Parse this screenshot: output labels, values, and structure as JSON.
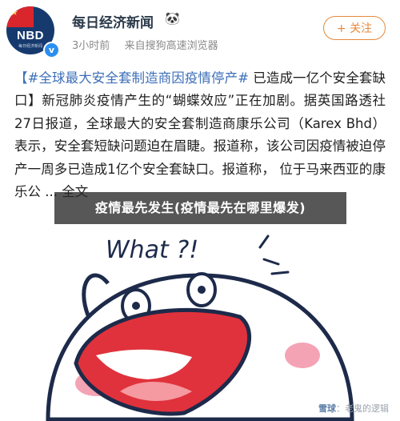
{
  "author": {
    "name": "每日经济新闻",
    "badges": "🐼",
    "avatar_logo": "NBD",
    "avatar_sub": "每日经济新闻"
  },
  "meta": {
    "time": "3小时前",
    "source": "来自搜狗高速浏览器"
  },
  "follow_button": "+ 关注",
  "post": {
    "hashtag": "【#全球最大安全套制造商因疫情停产#",
    "text": " 已造成一亿个安全套缺口】新冠肺炎疫情产生的“蝴蝶效应”正在加剧。据英国路透社27日报道，全球最大的安全套制造商康乐公司（Karex Bhd）表示，安全套短缺问题迫在眉睫。报道称，该公司因疫情被迫停产一周多已造成1亿个安全套缺口。报道称， 位于马来西亚的康乐公 ... 全文"
  },
  "overlay_caption": "疫情最先发生(疫情最先在哪里爆发)",
  "illustration_text": "What ?!",
  "watermark": {
    "brand": "雪球",
    "text": "：老鬼的逻辑"
  }
}
